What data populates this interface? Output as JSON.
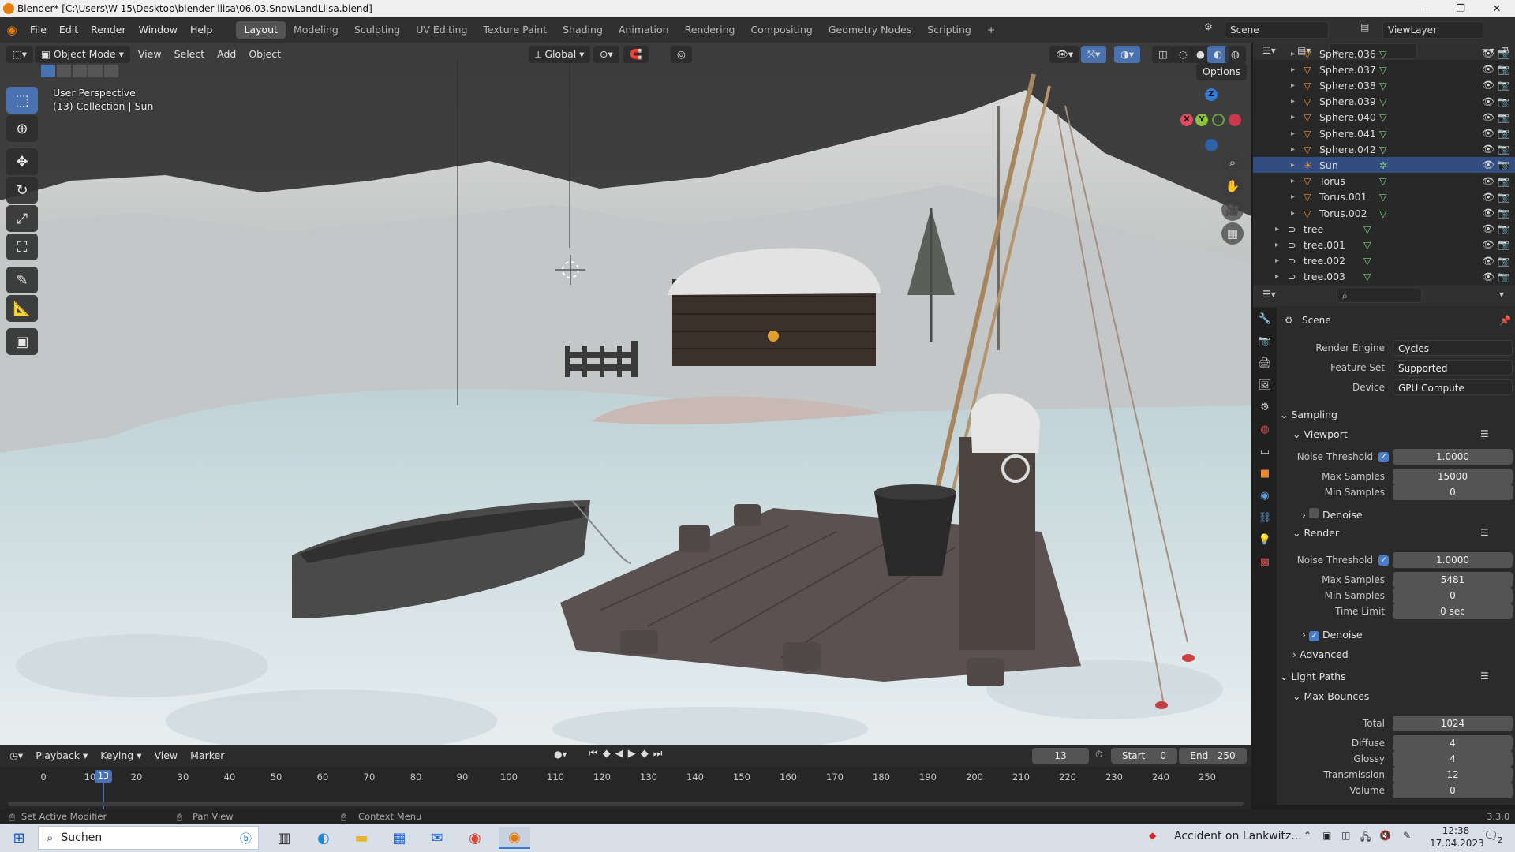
{
  "window": {
    "title": "Blender* [C:\\Users\\W 15\\Desktop\\blender liisa\\06.03.SnowLandLiisa.blend]"
  },
  "menu": {
    "items": [
      "File",
      "Edit",
      "Render",
      "Window",
      "Help"
    ]
  },
  "workspaces": [
    "Layout",
    "Modeling",
    "Sculpting",
    "UV Editing",
    "Texture Paint",
    "Shading",
    "Animation",
    "Rendering",
    "Compositing",
    "Geometry Nodes",
    "Scripting"
  ],
  "scene_field": "Scene",
  "viewlayer_field": "ViewLayer",
  "viewport": {
    "mode": "Object Mode",
    "menus": [
      "View",
      "Select",
      "Add",
      "Object"
    ],
    "transform_orientation": "Global",
    "options_label": "Options",
    "info_line1": "User Perspective",
    "info_line2": "(13) Collection | Sun",
    "gizmo": {
      "x": "X",
      "y": "Y",
      "z": "Z"
    }
  },
  "outliner": {
    "rows": [
      {
        "name": "Sphere.036"
      },
      {
        "name": "Sphere.037"
      },
      {
        "name": "Sphere.038"
      },
      {
        "name": "Sphere.039"
      },
      {
        "name": "Sphere.040"
      },
      {
        "name": "Sphere.041"
      },
      {
        "name": "Sphere.042"
      },
      {
        "name": "Sun"
      },
      {
        "name": "Torus"
      },
      {
        "name": "Torus.001"
      },
      {
        "name": "Torus.002"
      },
      {
        "name": "tree"
      },
      {
        "name": "tree.001"
      },
      {
        "name": "tree.002"
      },
      {
        "name": "tree.003"
      }
    ]
  },
  "properties": {
    "context": "Scene",
    "render_engine_label": "Render Engine",
    "render_engine": "Cycles",
    "feature_set_label": "Feature Set",
    "feature_set": "Supported",
    "device_label": "Device",
    "device": "GPU Compute",
    "sampling": "Sampling",
    "viewport_sub": "Viewport",
    "noise_threshold_label": "Noise Threshold",
    "vp_noise_threshold": "1.0000",
    "max_samples_label": "Max Samples",
    "vp_max_samples": "15000",
    "min_samples_label": "Min Samples",
    "vp_min_samples": "0",
    "denoise": "Denoise",
    "render_sub": "Render",
    "r_noise_threshold": "1.0000",
    "r_max_samples": "5481",
    "r_min_samples": "0",
    "time_limit_label": "Time Limit",
    "r_time_limit": "0 sec",
    "advanced": "Advanced",
    "light_paths": "Light Paths",
    "max_bounces": "Max Bounces",
    "total_label": "Total",
    "total": "1024",
    "diffuse_label": "Diffuse",
    "diffuse": "4",
    "glossy_label": "Glossy",
    "glossy": "4",
    "transmission_label": "Transmission",
    "transmission": "12",
    "volume_label": "Volume",
    "volume": "0"
  },
  "timeline": {
    "menus": [
      "Playback",
      "Keying",
      "View",
      "Marker"
    ],
    "current_frame": "13",
    "start_label": "Start",
    "start": "0",
    "end_label": "End",
    "end": "250",
    "ticks": [
      "0",
      "10",
      "20",
      "30",
      "40",
      "50",
      "60",
      "70",
      "80",
      "90",
      "100",
      "110",
      "120",
      "130",
      "140",
      "150",
      "160",
      "170",
      "180",
      "190",
      "200",
      "210",
      "220",
      "230",
      "240",
      "250"
    ]
  },
  "statusbar": {
    "left": "Set Active Modifier",
    "middle": "Pan View",
    "right": "Context Menu",
    "version": "3.3.0"
  },
  "taskbar": {
    "search": "Suchen",
    "news": "Accident on Lankwitz...",
    "time": "12:38",
    "date": "17.04.2023",
    "notification_count": "2"
  }
}
